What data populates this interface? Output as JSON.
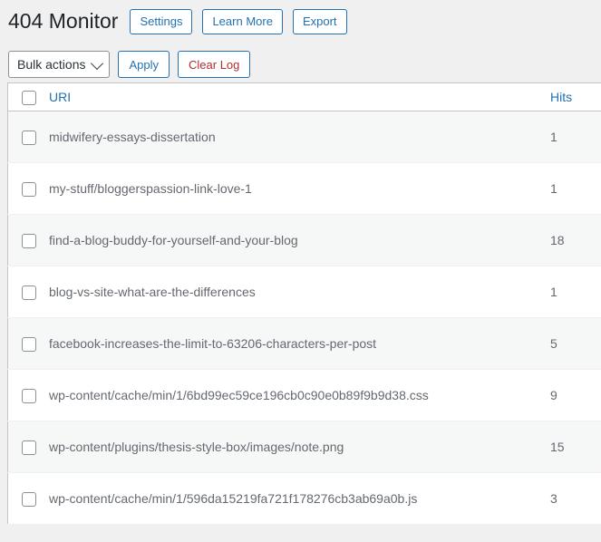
{
  "header": {
    "title": "404 Monitor",
    "buttons": [
      {
        "label": "Settings",
        "name": "settings-button"
      },
      {
        "label": "Learn More",
        "name": "learn-more-button"
      },
      {
        "label": "Export",
        "name": "export-button"
      }
    ]
  },
  "toolbar": {
    "bulk_actions_label": "Bulk actions",
    "apply_label": "Apply",
    "clear_log_label": "Clear Log"
  },
  "table": {
    "columns": {
      "uri": "URI",
      "hits": "Hits"
    },
    "rows": [
      {
        "uri": "midwifery-essays-dissertation",
        "hits": "1"
      },
      {
        "uri": "my-stuff/bloggerspassion-link-love-1",
        "hits": "1"
      },
      {
        "uri": "find-a-blog-buddy-for-yourself-and-your-blog",
        "hits": "18"
      },
      {
        "uri": "blog-vs-site-what-are-the-differences",
        "hits": "1"
      },
      {
        "uri": "facebook-increases-the-limit-to-63206-characters-per-post",
        "hits": "5"
      },
      {
        "uri": "wp-content/cache/min/1/6bd99ec59ce196cb0c90e0b89f9b9d38.css",
        "hits": "9"
      },
      {
        "uri": "wp-content/plugins/thesis-style-box/images/note.png",
        "hits": "15"
      },
      {
        "uri": "wp-content/cache/min/1/596da15219fa721f178276cb3ab69a0b.js",
        "hits": "3"
      }
    ]
  },
  "colors": {
    "accent": "#2271b1",
    "danger": "#b32d2e",
    "background": "#f0f0f1",
    "stripe": "#f6f7f7"
  }
}
